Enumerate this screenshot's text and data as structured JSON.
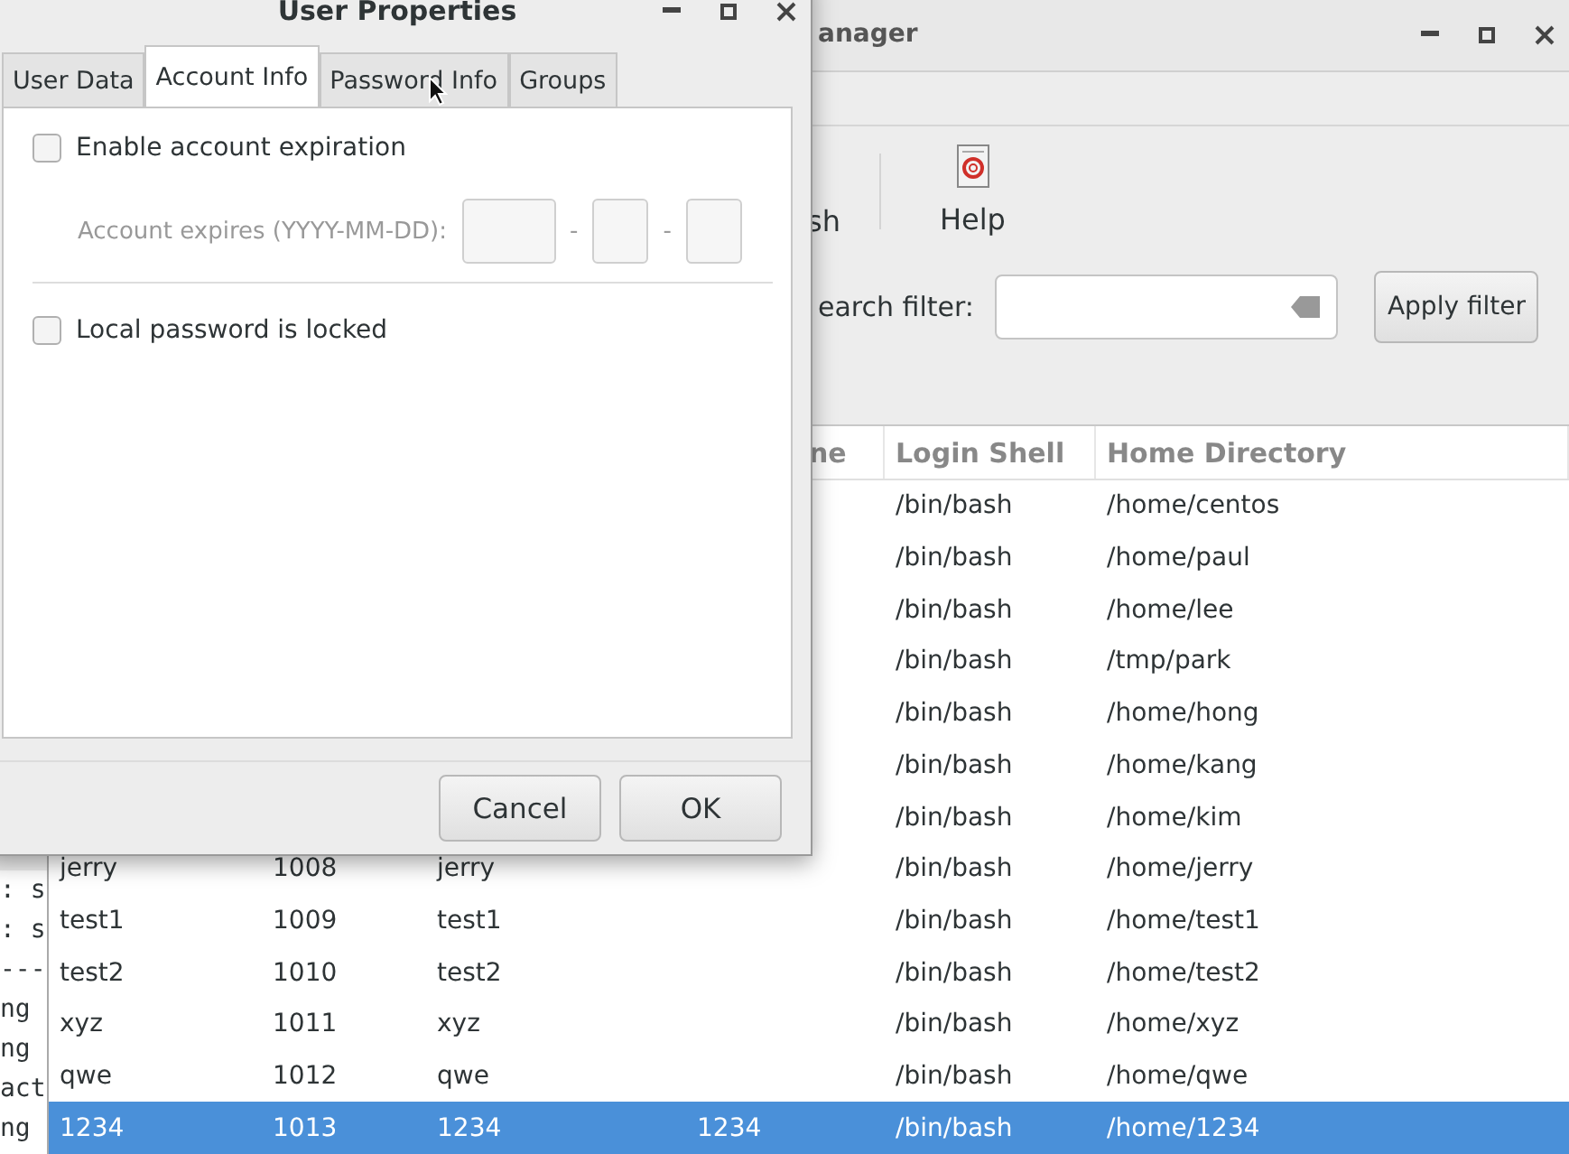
{
  "terminal": {
    "lines": [
      ": s",
      ": s",
      "---",
      "ng",
      "ng",
      "act",
      "ng"
    ]
  },
  "main_window": {
    "title": "anager",
    "toolbar": [
      {
        "kind": "text",
        "label": "sh"
      },
      {
        "kind": "help",
        "label": "Help"
      }
    ],
    "search": {
      "label": "earch filter:"
    },
    "apply_button": "Apply filter",
    "table": {
      "columns": [
        "",
        "",
        "",
        "ne",
        "Login Shell",
        "Home Directory"
      ],
      "rows": [
        {
          "cells": [
            "",
            "",
            "",
            "",
            "/bin/bash",
            "/home/centos"
          ],
          "selected": false
        },
        {
          "cells": [
            "",
            "",
            "",
            "",
            "/bin/bash",
            "/home/paul"
          ],
          "selected": false
        },
        {
          "cells": [
            "",
            "",
            "",
            "",
            "/bin/bash",
            "/home/lee"
          ],
          "selected": false
        },
        {
          "cells": [
            "",
            "",
            "",
            "",
            "/bin/bash",
            "/tmp/park"
          ],
          "selected": false
        },
        {
          "cells": [
            "",
            "",
            "",
            "",
            "/bin/bash",
            "/home/hong"
          ],
          "selected": false
        },
        {
          "cells": [
            "",
            "",
            "",
            "",
            "/bin/bash",
            "/home/kang"
          ],
          "selected": false
        },
        {
          "cells": [
            "",
            "",
            "",
            "",
            "/bin/bash",
            "/home/kim"
          ],
          "selected": false
        },
        {
          "cells": [
            "jerry",
            "1008",
            "jerry",
            "",
            "/bin/bash",
            "/home/jerry"
          ],
          "selected": false
        },
        {
          "cells": [
            "test1",
            "1009",
            "test1",
            "",
            "/bin/bash",
            "/home/test1"
          ],
          "selected": false
        },
        {
          "cells": [
            "test2",
            "1010",
            "test2",
            "",
            "/bin/bash",
            "/home/test2"
          ],
          "selected": false
        },
        {
          "cells": [
            "xyz",
            "1011",
            "xyz",
            "",
            "/bin/bash",
            "/home/xyz"
          ],
          "selected": false
        },
        {
          "cells": [
            "qwe",
            "1012",
            "qwe",
            "",
            "/bin/bash",
            "/home/qwe"
          ],
          "selected": false
        },
        {
          "cells": [
            "1234",
            "1013",
            "1234",
            "1234",
            "/bin/bash",
            "/home/1234"
          ],
          "selected": true
        }
      ]
    }
  },
  "dialog": {
    "title": "User Properties",
    "tabs": [
      {
        "label": "User Data",
        "selected": false
      },
      {
        "label": "Account Info",
        "selected": true
      },
      {
        "label": "Password Info",
        "selected": false
      },
      {
        "label": "Groups",
        "selected": false
      }
    ],
    "expiration": {
      "label": "Enable account expiration",
      "checked": false
    },
    "expires": {
      "label": "Account expires (YYYY-MM-DD):",
      "disabled": true,
      "separators": [
        "-",
        "-"
      ]
    },
    "locked": {
      "label": "Local password is locked",
      "checked": false
    },
    "buttons": [
      "Cancel",
      "OK"
    ]
  }
}
